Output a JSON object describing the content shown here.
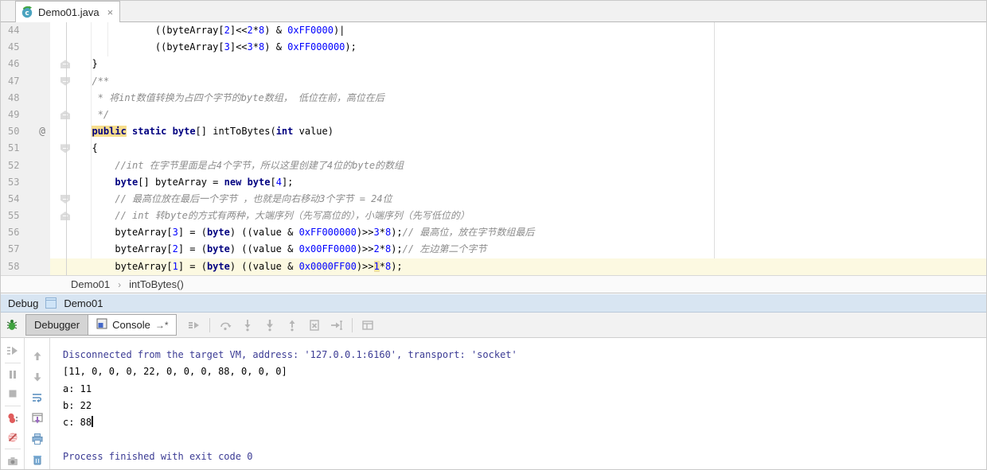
{
  "editor_tab": {
    "title": "Demo01.java",
    "icon": "java-class-icon",
    "close": "×"
  },
  "colors": {
    "keyword": "#000080",
    "number": "#0000ff",
    "comment": "#8c8c8c",
    "system_output": "#3b3b94",
    "current_line": "#fcf9e1",
    "identifier_highlight": "#f7dd8c",
    "toolwindow_header": "#d8e5f2"
  },
  "editor": {
    "lines": [
      {
        "n": "44",
        "seg": [
          [
            "p",
            "             ((byteArray["
          ],
          [
            "n",
            "2"
          ],
          [
            "p",
            "]<<"
          ],
          [
            "n",
            "2"
          ],
          [
            "p",
            "*"
          ],
          [
            "n",
            "8"
          ],
          [
            "p",
            ") & "
          ],
          [
            "n",
            "0xFF0000"
          ],
          [
            "p",
            ")|"
          ]
        ]
      },
      {
        "n": "45",
        "seg": [
          [
            "p",
            "             ((byteArray["
          ],
          [
            "n",
            "3"
          ],
          [
            "p",
            "]<<"
          ],
          [
            "n",
            "3"
          ],
          [
            "p",
            "*"
          ],
          [
            "n",
            "8"
          ],
          [
            "p",
            ") & "
          ],
          [
            "n",
            "0xFF000000"
          ],
          [
            "p",
            ");"
          ]
        ]
      },
      {
        "n": "46",
        "fold": "u",
        "seg": [
          [
            "p",
            "  }"
          ]
        ]
      },
      {
        "n": "47",
        "fold": "d",
        "seg": [
          [
            "c",
            "  /**"
          ]
        ]
      },
      {
        "n": "48",
        "seg": [
          [
            "c",
            "   * 将int数值转换为占四个字节的byte数组， 低位在前，高位在后"
          ]
        ]
      },
      {
        "n": "49",
        "fold": "u",
        "seg": [
          [
            "c",
            "   */"
          ]
        ]
      },
      {
        "n": "50",
        "mark": "@",
        "seg": [
          [
            "p",
            "  "
          ],
          [
            "khl",
            "public"
          ],
          [
            "p",
            " "
          ],
          [
            "k",
            "static"
          ],
          [
            "p",
            " "
          ],
          [
            "k",
            "byte"
          ],
          [
            "p",
            "[] intToBytes("
          ],
          [
            "k",
            "int"
          ],
          [
            "p",
            " value)"
          ]
        ]
      },
      {
        "n": "51",
        "fold": "d",
        "seg": [
          [
            "p",
            "  {"
          ]
        ]
      },
      {
        "n": "52",
        "seg": [
          [
            "c",
            "      //int 在字节里面是占4个字节，所以这里创建了4位的byte的数组"
          ]
        ]
      },
      {
        "n": "53",
        "seg": [
          [
            "p",
            "      "
          ],
          [
            "k",
            "byte"
          ],
          [
            "p",
            "[] byteArray = "
          ],
          [
            "k",
            "new"
          ],
          [
            "p",
            " "
          ],
          [
            "k",
            "byte"
          ],
          [
            "p",
            "["
          ],
          [
            "n",
            "4"
          ],
          [
            "p",
            "];"
          ]
        ]
      },
      {
        "n": "54",
        "fold": "d",
        "seg": [
          [
            "c",
            "      // 最高位放在最后一个字节 ，也就是向右移动3个字节 = 24位"
          ]
        ]
      },
      {
        "n": "55",
        "fold": "u",
        "seg": [
          [
            "c",
            "      // int 转byte的方式有两种，大端序列（先写高位的），小端序列（先写低位的）"
          ]
        ]
      },
      {
        "n": "56",
        "seg": [
          [
            "p",
            "      byteArray["
          ],
          [
            "n",
            "3"
          ],
          [
            "p",
            "] = ("
          ],
          [
            "k",
            "byte"
          ],
          [
            "p",
            ") ((value & "
          ],
          [
            "n",
            "0xFF000000"
          ],
          [
            "p",
            ")>>"
          ],
          [
            "n",
            "3"
          ],
          [
            "p",
            "*"
          ],
          [
            "n",
            "8"
          ],
          [
            "p",
            ");"
          ],
          [
            "c",
            "// 最高位，放在字节数组最后"
          ]
        ]
      },
      {
        "n": "57",
        "seg": [
          [
            "p",
            "      byteArray["
          ],
          [
            "n",
            "2"
          ],
          [
            "p",
            "] = ("
          ],
          [
            "k",
            "byte"
          ],
          [
            "p",
            ") ((value & "
          ],
          [
            "n",
            "0x00FF0000"
          ],
          [
            "p",
            ")>>"
          ],
          [
            "n",
            "2"
          ],
          [
            "p",
            "*"
          ],
          [
            "n",
            "8"
          ],
          [
            "p",
            ");"
          ],
          [
            "c",
            "// 左边第二个字节"
          ]
        ]
      },
      {
        "n": "58",
        "cur": true,
        "seg": [
          [
            "p",
            "      byteArray["
          ],
          [
            "n",
            "1"
          ],
          [
            "p",
            "] = ("
          ],
          [
            "k",
            "byte"
          ],
          [
            "p",
            ") ((value & "
          ],
          [
            "n",
            "0x0000FF00"
          ],
          [
            "p",
            ")>>"
          ],
          [
            "nsel",
            "1"
          ],
          [
            "p",
            "*"
          ],
          [
            "n",
            "8"
          ],
          [
            "p",
            ");"
          ]
        ]
      }
    ]
  },
  "breadcrumb": {
    "class": "Demo01",
    "sep": "›",
    "method": "intToBytes()"
  },
  "debug_panel": {
    "title": "Debug",
    "session": "Demo01",
    "tabs": [
      {
        "label": "Debugger"
      },
      {
        "label": "Console",
        "pin": "→*"
      }
    ],
    "actions": [
      "show-execution-point",
      "sep",
      "step-over",
      "step-into",
      "force-step-into",
      "step-out",
      "drop-frame",
      "run-to-cursor",
      "sep",
      "restore-layout"
    ],
    "debug_controls": [
      "rerun",
      "sep",
      "pause",
      "stop",
      "sep",
      "view-breakpoints",
      "mute-breakpoints",
      "sep",
      "thread-dump"
    ],
    "console_controls": [
      "scroll-up",
      "scroll-down",
      "soft-wrap",
      "scroll-to-end",
      "print",
      "clear-all"
    ]
  },
  "console": {
    "lines": [
      {
        "style": "sys",
        "text": "Disconnected from the target VM, address: '127.0.0.1:6160', transport: 'socket'"
      },
      {
        "style": "out",
        "text": "[11, 0, 0, 0, 22, 0, 0, 0, 88, 0, 0, 0]"
      },
      {
        "style": "out",
        "text": "a: 11"
      },
      {
        "style": "out",
        "text": "b: 22"
      },
      {
        "style": "out",
        "text": "c: 88",
        "caret": true
      },
      {
        "style": "out",
        "text": ""
      },
      {
        "style": "sys",
        "text": "Process finished with exit code 0"
      }
    ]
  }
}
